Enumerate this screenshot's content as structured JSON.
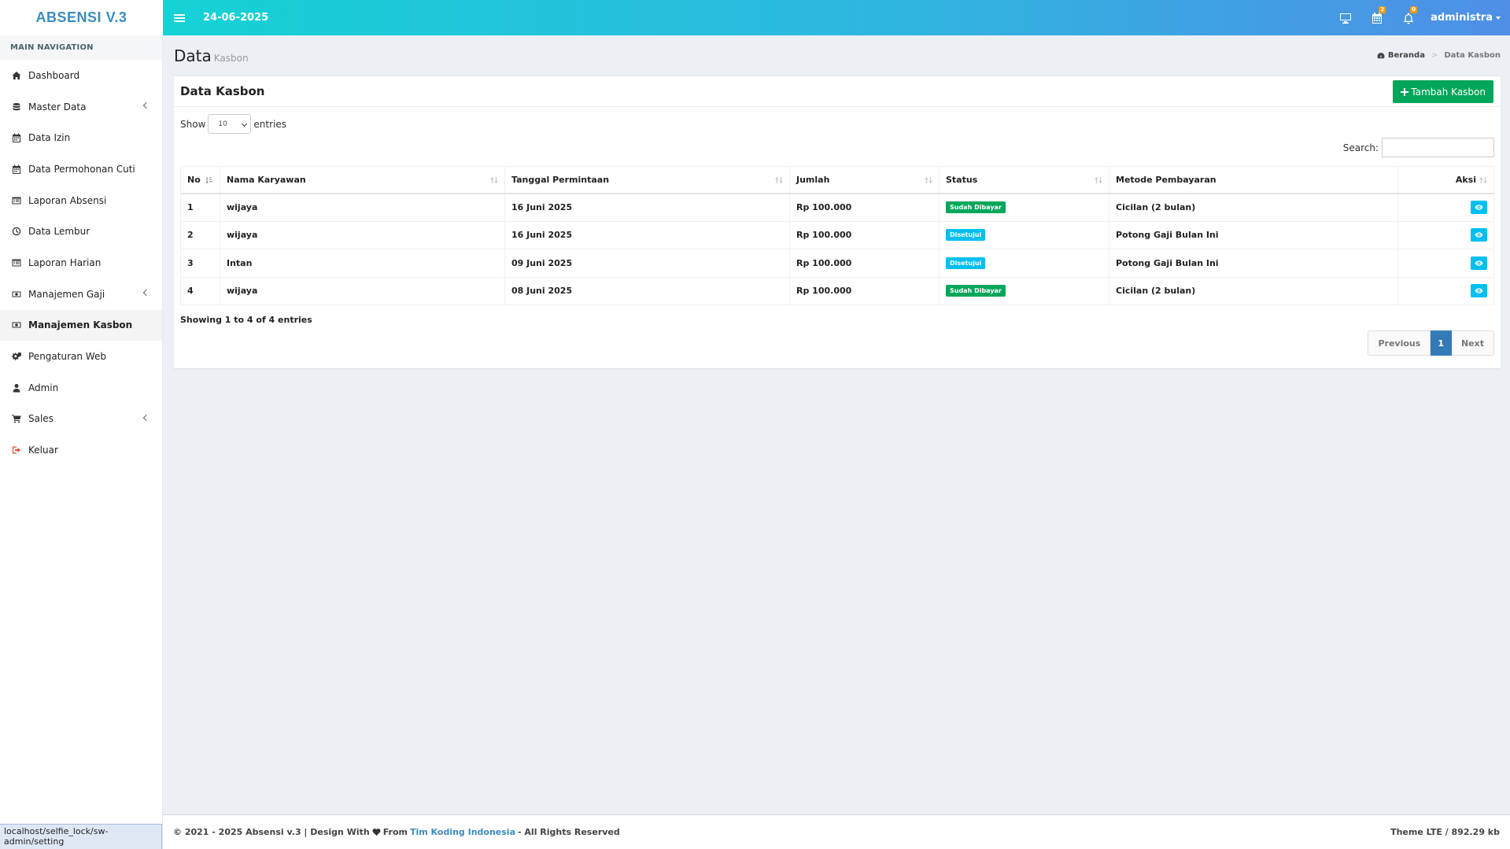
{
  "app": {
    "logo": "ABSENSI V.3"
  },
  "navbar": {
    "date": "24-06-2025",
    "calendar_badge": "2",
    "bell_badge": "0",
    "user": "administra"
  },
  "sidebar": {
    "header": "MAIN NAVIGATION",
    "items": [
      {
        "label": "Dashboard",
        "icon": "home-icon"
      },
      {
        "label": "Master Data",
        "icon": "database-icon",
        "submenu": true
      },
      {
        "label": "Data Izin",
        "icon": "calendar-icon"
      },
      {
        "label": "Data Permohonan Cuti",
        "icon": "calendar-icon"
      },
      {
        "label": "Laporan Absensi",
        "icon": "list-alt-icon"
      },
      {
        "label": "Data Lembur",
        "icon": "clock-icon"
      },
      {
        "label": "Laporan Harian",
        "icon": "list-alt-icon"
      },
      {
        "label": "Manajemen Gaji",
        "icon": "money-icon",
        "submenu": true
      },
      {
        "label": "Manajemen Kasbon",
        "icon": "money-icon",
        "active": true
      },
      {
        "label": "Pengaturan Web",
        "icon": "cogs-icon"
      },
      {
        "label": "Admin",
        "icon": "user-icon"
      },
      {
        "label": "Sales",
        "icon": "cart-icon",
        "submenu": true
      },
      {
        "label": "Keluar",
        "icon": "sign-out-icon"
      }
    ]
  },
  "status_url": "localhost/selfie_lock/sw-admin/setting",
  "page": {
    "title": "Data",
    "subtitle": "Kasbon",
    "breadcrumb": {
      "home": "Beranda",
      "current": "Data Kasbon"
    }
  },
  "box": {
    "title": "Data Kasbon",
    "add_button": "Tambah Kasbon",
    "show_label": "Show",
    "entries_label": "entries",
    "page_length": "10",
    "search_label": "Search:",
    "search_value": ""
  },
  "table": {
    "headers": [
      "No",
      "Nama Karyawan",
      "Tanggal Permintaan",
      "Jumlah",
      "Status",
      "Metode Pembayaran",
      "Aksi"
    ],
    "rows": [
      {
        "no": "1",
        "nama": "wijaya",
        "tanggal": "16 Juni 2025",
        "jumlah": "Rp 100.000",
        "status": "Sudah Dibayar",
        "metode": "Cicilan (2 bulan)"
      },
      {
        "no": "2",
        "nama": "wijaya",
        "tanggal": "16 Juni 2025",
        "jumlah": "Rp 100.000",
        "status": "Disetujui",
        "metode": "Potong Gaji Bulan Ini"
      },
      {
        "no": "3",
        "nama": "Intan",
        "tanggal": "09 Juni 2025",
        "jumlah": "Rp 100.000",
        "status": "Disetujui",
        "metode": "Potong Gaji Bulan Ini"
      },
      {
        "no": "4",
        "nama": "wijaya",
        "tanggal": "08 Juni 2025",
        "jumlah": "Rp 100.000",
        "status": "Sudah Dibayar",
        "metode": "Cicilan (2 bulan)"
      }
    ]
  },
  "pagination": {
    "info": "Showing 1 to 4 of 4 entries",
    "previous": "Previous",
    "current": "1",
    "next": "Next"
  },
  "footer": {
    "left_prefix": "© 2021 - 2025 Absensi v.3 | Design With",
    "left_from": "From",
    "link": "Tim Koding Indonesia",
    "left_suffix": "- All Rights Reserved",
    "right": "Theme LTE / 892.29 kb"
  },
  "colors": {
    "accent": "#3c8dbc",
    "success": "#00a65a",
    "info": "#00c0ef",
    "header_start": "#15d2d5",
    "header_end": "#4f8fe6"
  }
}
